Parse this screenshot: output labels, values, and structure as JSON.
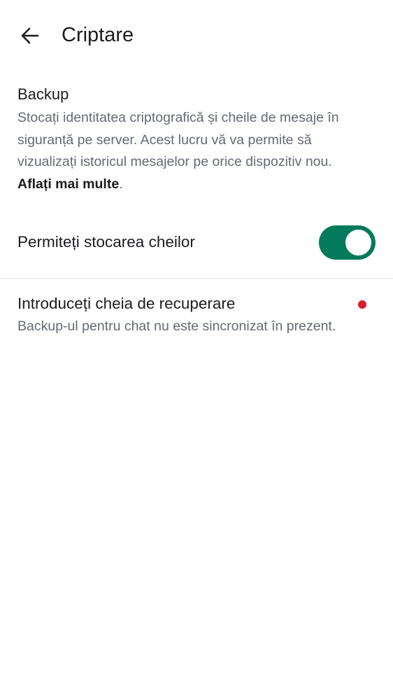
{
  "header": {
    "title": "Criptare",
    "back_icon": "arrow-left-icon"
  },
  "backup": {
    "title": "Backup",
    "description": "Stocați identitatea criptografică și cheile de mesaje în siguranță pe server. Acest lucru vă va permite să vizualizați istoricul mesajelor pe orice dispozitiv nou. ",
    "learn_more": "Aflați mai multe",
    "period": "."
  },
  "allow_storage": {
    "label": "Permiteți stocarea cheilor",
    "enabled": true,
    "accent": "#047a5c"
  },
  "recovery": {
    "title": "Introduceți cheia de recuperare",
    "description": "Backup-ul pentru chat nu este sincronizat în prezent.",
    "badge_color": "#d61f2c"
  }
}
